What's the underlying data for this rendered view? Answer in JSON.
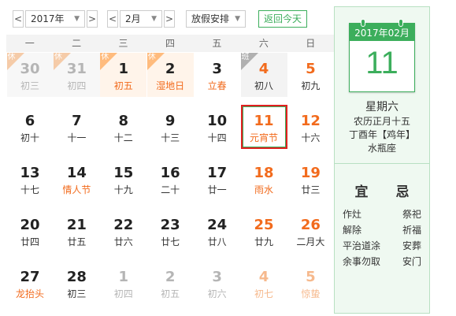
{
  "toolbar": {
    "year": "2017年",
    "month": "2月",
    "holiday": "放假安排",
    "today_button": "返回今天",
    "prev": "<",
    "next": ">"
  },
  "weekdays": [
    "一",
    "二",
    "三",
    "四",
    "五",
    "六",
    "日"
  ],
  "days": [
    {
      "d": "30",
      "l": "初三",
      "style": "faded",
      "tag": "休"
    },
    {
      "d": "31",
      "l": "初四",
      "style": "faded",
      "tag": "休"
    },
    {
      "d": "1",
      "l": "初五",
      "style": "holiday",
      "tag": "休"
    },
    {
      "d": "2",
      "l": "湿地日",
      "style": "holiday",
      "tag": "休"
    },
    {
      "d": "3",
      "l": "立春",
      "style": "festival"
    },
    {
      "d": "4",
      "l": "初八",
      "style": "work",
      "tag": "班"
    },
    {
      "d": "5",
      "l": "初九",
      "style": "weekend"
    },
    {
      "d": "6",
      "l": "初十"
    },
    {
      "d": "7",
      "l": "十一"
    },
    {
      "d": "8",
      "l": "十二"
    },
    {
      "d": "9",
      "l": "十三"
    },
    {
      "d": "10",
      "l": "十四"
    },
    {
      "d": "11",
      "l": "元宵节",
      "style": "selected"
    },
    {
      "d": "12",
      "l": "十六",
      "style": "weekend"
    },
    {
      "d": "13",
      "l": "十七"
    },
    {
      "d": "14",
      "l": "情人节",
      "style": "festival"
    },
    {
      "d": "15",
      "l": "十九"
    },
    {
      "d": "16",
      "l": "二十"
    },
    {
      "d": "17",
      "l": "廿一"
    },
    {
      "d": "18",
      "l": "雨水",
      "style": "weekendfest"
    },
    {
      "d": "19",
      "l": "廿三",
      "style": "weekend"
    },
    {
      "d": "20",
      "l": "廿四"
    },
    {
      "d": "21",
      "l": "廿五"
    },
    {
      "d": "22",
      "l": "廿六"
    },
    {
      "d": "23",
      "l": "廿七"
    },
    {
      "d": "24",
      "l": "廿八"
    },
    {
      "d": "25",
      "l": "廿九",
      "style": "weekend"
    },
    {
      "d": "26",
      "l": "二月大",
      "style": "weekend"
    },
    {
      "d": "27",
      "l": "龙抬头",
      "style": "festival"
    },
    {
      "d": "28",
      "l": "初三"
    },
    {
      "d": "1",
      "l": "初四",
      "style": "faded"
    },
    {
      "d": "2",
      "l": "初五",
      "style": "faded"
    },
    {
      "d": "3",
      "l": "初六",
      "style": "faded"
    },
    {
      "d": "4",
      "l": "初七",
      "style": "fadedweekend"
    },
    {
      "d": "5",
      "l": "惊蛰",
      "style": "fadedweekend"
    }
  ],
  "sidebar": {
    "header": "2017年02月",
    "day": "11",
    "weekday": "星期六",
    "lunar": "农历正月十五",
    "ganzhi": "丁酉年【鸡年】",
    "zodiac": "水瓶座",
    "yi_label": "宜",
    "ji_label": "忌",
    "yi_items": [
      "作灶",
      "解除",
      "平治道涂",
      "余事勿取"
    ],
    "ji_items": [
      "祭祀",
      "祈福",
      "安葬",
      "安门"
    ]
  },
  "colors": {
    "accent": "#3cae5c",
    "weekend": "#f26b1d",
    "holiday_bg": "#fff4ea",
    "selected_border": "#e02020"
  }
}
